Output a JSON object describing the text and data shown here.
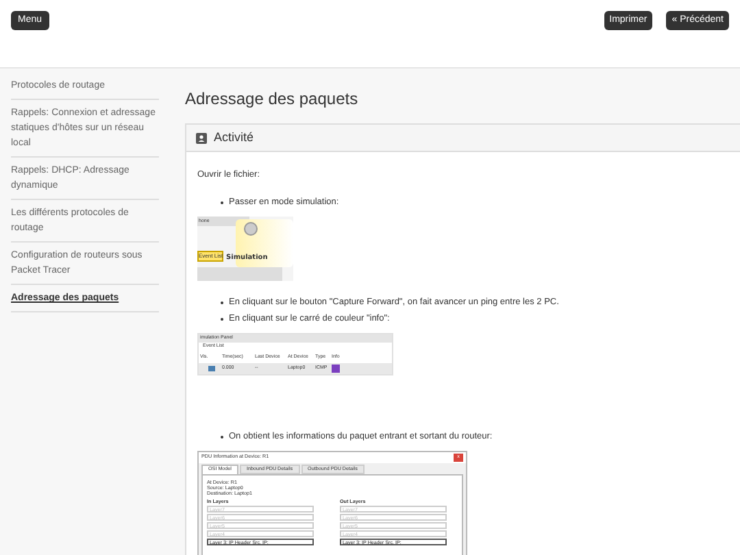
{
  "header": {
    "menu_button": "Menu",
    "buttons": [
      "Imprimer",
      "« Précédent"
    ]
  },
  "sidebar": {
    "items": [
      {
        "label": "Protocoles de routage",
        "selected": false
      },
      {
        "label": "Rappels: Connexion et adressage statiques d'hôtes sur un réseau local",
        "selected": false
      },
      {
        "label": "Rappels: DHCP: Adressage dynamique",
        "selected": false
      },
      {
        "label": "Les différents protocoles de routage",
        "selected": false
      },
      {
        "label": "Configuration de routeurs sous Packet Tracer",
        "selected": false
      },
      {
        "label": "Adressage des paquets",
        "selected": true
      }
    ]
  },
  "page_title": "Adressage des paquets",
  "card": {
    "title": "Activité",
    "blocks": [
      {
        "kind": "paragraph",
        "text": "Ouvrir le fichier:"
      },
      {
        "kind": "bullets",
        "items": [
          "Passer en mode simulation:"
        ]
      },
      {
        "kind": "simulation_shot",
        "top_label": "hone",
        "event_list": "Event List",
        "mode": "Simulation"
      },
      {
        "kind": "bullets",
        "items": [
          "En cliquant sur le bouton \"Capture Forward\", on fait avancer un ping entre les 2 PC.",
          "En cliquant sur le carré de couleur \"info\":"
        ]
      },
      {
        "kind": "panel_shot",
        "title": "imulation Panel",
        "subtitle": "Event List",
        "columns": [
          "Vis.",
          "Time(sec)",
          "Last Device",
          "At Device",
          "Type",
          "Info"
        ],
        "row": {
          "time": "0.000",
          "last_device": "--",
          "at_device": "Laptop0",
          "type": "ICMP",
          "color": "#7b3fbf"
        }
      },
      {
        "kind": "bullets",
        "items": [
          "On obtient les informations du paquet entrant et sortant du routeur:"
        ]
      },
      {
        "kind": "pdu_shot",
        "title": "PDU Information at Device: R1",
        "close": "x",
        "tabs": [
          {
            "label": "OSI Model",
            "selected": true
          },
          {
            "label": "Inbound PDU Details",
            "selected": false
          },
          {
            "label": "Outbound PDU Details",
            "selected": false
          }
        ],
        "info": [
          "At Device: R1",
          "Source: Laptop0",
          "Destination: Laptop1"
        ],
        "columns": [
          {
            "heading": "In Layers",
            "layers": [
              {
                "label": "Layer7",
                "disabled": true
              },
              {
                "label": "Layer6",
                "disabled": true
              },
              {
                "label": "Layer5",
                "disabled": true
              },
              {
                "label": "Layer4",
                "disabled": true
              },
              {
                "label": "Layer 3: IP Header Src. IP:",
                "disabled": false
              }
            ]
          },
          {
            "heading": "Out Layers",
            "layers": [
              {
                "label": "Layer7",
                "disabled": true
              },
              {
                "label": "Layer6",
                "disabled": true
              },
              {
                "label": "Layer5",
                "disabled": true
              },
              {
                "label": "Layer4",
                "disabled": true
              },
              {
                "label": "Layer 3: IP Header Src. IP:",
                "disabled": false
              }
            ]
          }
        ]
      }
    ]
  }
}
